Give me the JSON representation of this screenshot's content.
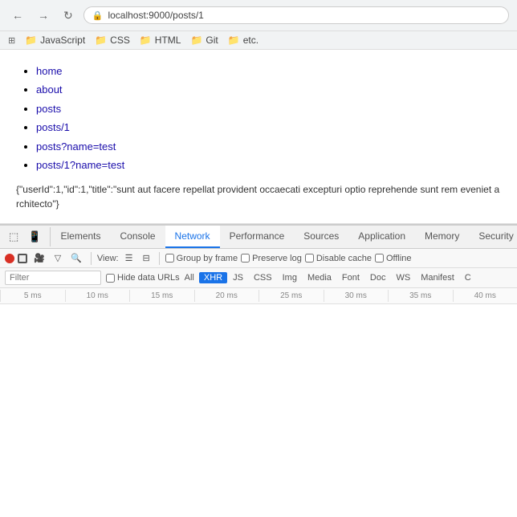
{
  "browser": {
    "back_label": "←",
    "forward_label": "→",
    "reload_label": "↻",
    "url": "localhost:9000/posts/1",
    "bookmarks": [
      {
        "label": "JavaScript",
        "icon": "⊞"
      },
      {
        "label": "CSS",
        "icon": "📁"
      },
      {
        "label": "HTML",
        "icon": "📁"
      },
      {
        "label": "Git",
        "icon": "📁"
      },
      {
        "label": "etc.",
        "icon": "📁"
      }
    ]
  },
  "page": {
    "links": [
      {
        "text": "home",
        "href": "#"
      },
      {
        "text": "about",
        "href": "#"
      },
      {
        "text": "posts",
        "href": "#"
      },
      {
        "text": "posts/1",
        "href": "#"
      },
      {
        "text": "posts?name=test",
        "href": "#"
      },
      {
        "text": "posts/1?name=test",
        "href": "#"
      }
    ],
    "json_text": "{\"userId\":1,\"id\":1,\"title\":\"sunt aut facere repellat provident occaecati excepturi optio reprehende sunt rem eveniet architecto\"}"
  },
  "devtools": {
    "tabs": [
      {
        "label": "Elements",
        "active": false
      },
      {
        "label": "Console",
        "active": false
      },
      {
        "label": "Network",
        "active": true
      },
      {
        "label": "Performance",
        "active": false
      },
      {
        "label": "Sources",
        "active": false
      },
      {
        "label": "Application",
        "active": false
      },
      {
        "label": "Memory",
        "active": false
      },
      {
        "label": "Security",
        "active": false
      }
    ],
    "network": {
      "view_label": "View:",
      "preserve_log_label": "Preserve log",
      "disable_cache_label": "Disable cache",
      "offline_label": "Offline",
      "group_by_frame_label": "Group by frame",
      "filter_placeholder": "Filter",
      "hide_data_urls_label": "Hide data URLs",
      "all_label": "All",
      "filter_types": [
        "XHR",
        "JS",
        "CSS",
        "Img",
        "Media",
        "Font",
        "Doc",
        "WS",
        "Manifest",
        "C"
      ],
      "active_filter": "XHR",
      "timeline_ticks": [
        "5 ms",
        "10 ms",
        "15 ms",
        "20 ms",
        "25 ms",
        "30 ms",
        "35 ms",
        "40 ms"
      ]
    }
  }
}
